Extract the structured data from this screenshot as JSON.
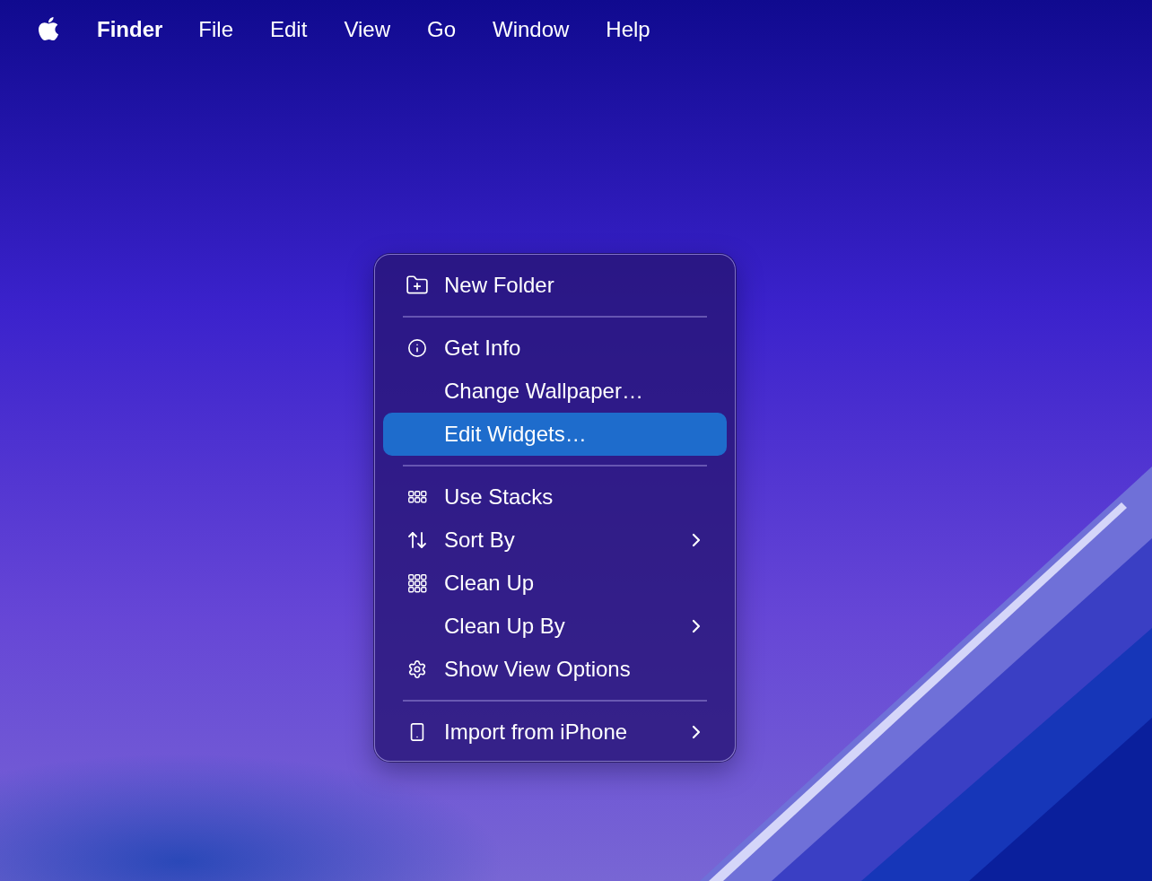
{
  "menu_bar": {
    "items": [
      {
        "label": "Finder",
        "kind": "app"
      },
      {
        "label": "File",
        "kind": "menu"
      },
      {
        "label": "Edit",
        "kind": "menu"
      },
      {
        "label": "View",
        "kind": "menu"
      },
      {
        "label": "Go",
        "kind": "menu"
      },
      {
        "label": "Window",
        "kind": "menu"
      },
      {
        "label": "Help",
        "kind": "menu"
      }
    ]
  },
  "context_menu": {
    "items": [
      {
        "kind": "item",
        "label": "New Folder",
        "selected": false,
        "submenu": false
      },
      {
        "kind": "separator"
      },
      {
        "kind": "item",
        "label": "Get Info",
        "selected": false,
        "submenu": false
      },
      {
        "kind": "item",
        "label": "Change Wallpaper…",
        "selected": false,
        "submenu": false
      },
      {
        "kind": "item",
        "label": "Edit Widgets…",
        "selected": true,
        "submenu": false
      },
      {
        "kind": "separator"
      },
      {
        "kind": "item",
        "label": "Use Stacks",
        "selected": false,
        "submenu": false
      },
      {
        "kind": "item",
        "label": "Sort By",
        "selected": false,
        "submenu": true
      },
      {
        "kind": "item",
        "label": "Clean Up",
        "selected": false,
        "submenu": false
      },
      {
        "kind": "item",
        "label": "Clean Up By",
        "selected": false,
        "submenu": true
      },
      {
        "kind": "item",
        "label": "Show View Options",
        "selected": false,
        "submenu": false
      },
      {
        "kind": "separator"
      },
      {
        "kind": "item",
        "label": "Import from iPhone",
        "selected": false,
        "submenu": true
      }
    ]
  }
}
